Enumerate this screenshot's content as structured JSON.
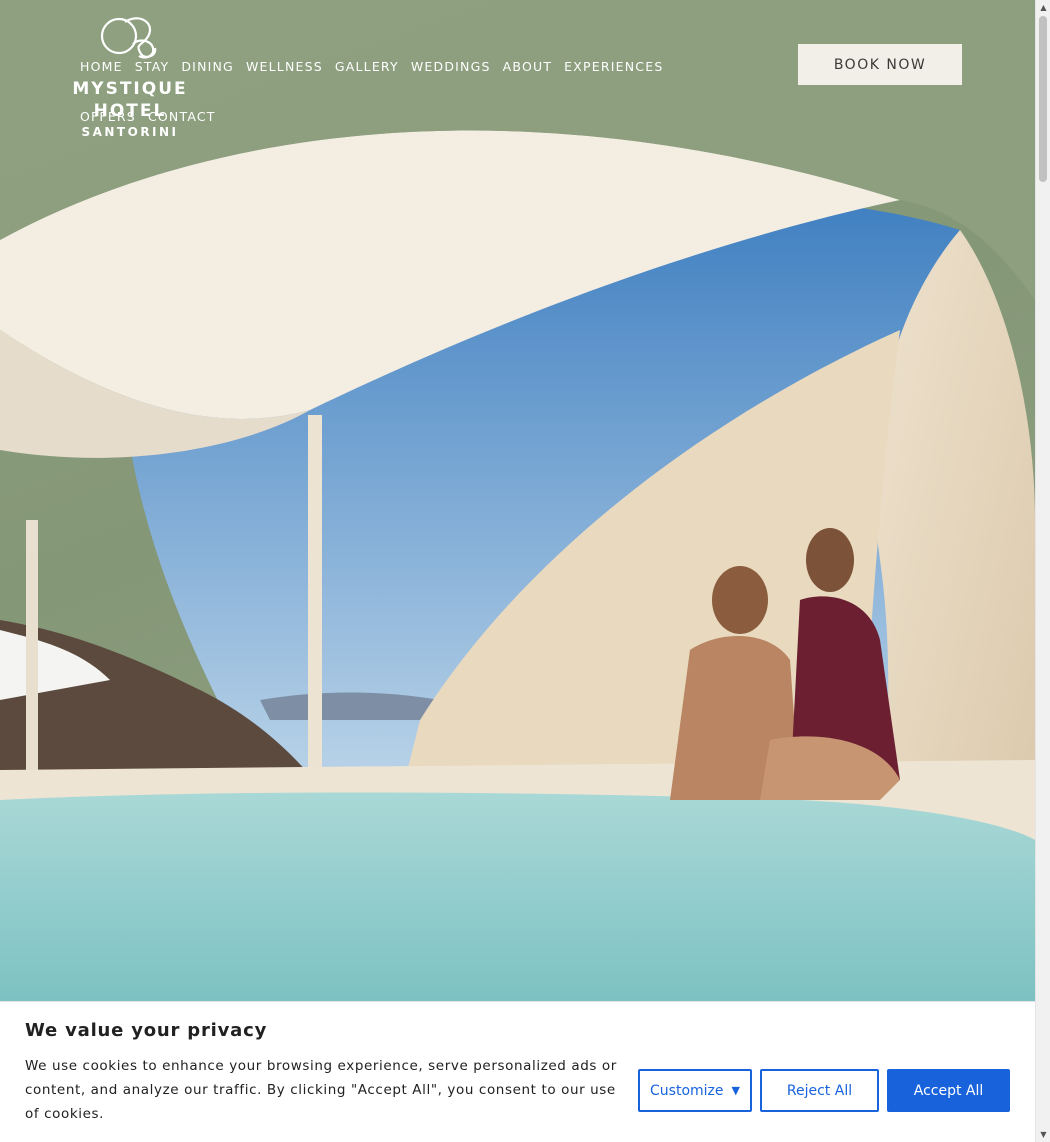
{
  "header": {
    "logo": {
      "name_line1": "MYSTIQUE",
      "name_line2": "HOTEL",
      "subtitle": "SANTORINI",
      "icon": "mystique-logo-mark"
    },
    "nav": [
      {
        "label": "HOME"
      },
      {
        "label": "STAY"
      },
      {
        "label": "DINING"
      },
      {
        "label": "WELLNESS"
      },
      {
        "label": "GALLERY"
      },
      {
        "label": "WEDDINGS"
      },
      {
        "label": "ABOUT"
      },
      {
        "label": "EXPERIENCES"
      },
      {
        "label": "OFFERS"
      },
      {
        "label": "CONTACT"
      }
    ],
    "book_label": "BOOK NOW"
  },
  "hero": {
    "image": "couple-in-cave-pool-santorini"
  },
  "cookie_banner": {
    "title": "We value your privacy",
    "text": "We use cookies to enhance your browsing experience, serve personalized ads or content, and analyze our traffic. By clicking \"Accept All\", you consent to our use of cookies.",
    "customize_label": "Customize",
    "reject_label": "Reject All",
    "accept_label": "Accept All",
    "accent_color": "#1863dc"
  },
  "scrollbar": {
    "up_icon": "triangle-up-icon",
    "down_icon": "triangle-down-icon"
  }
}
